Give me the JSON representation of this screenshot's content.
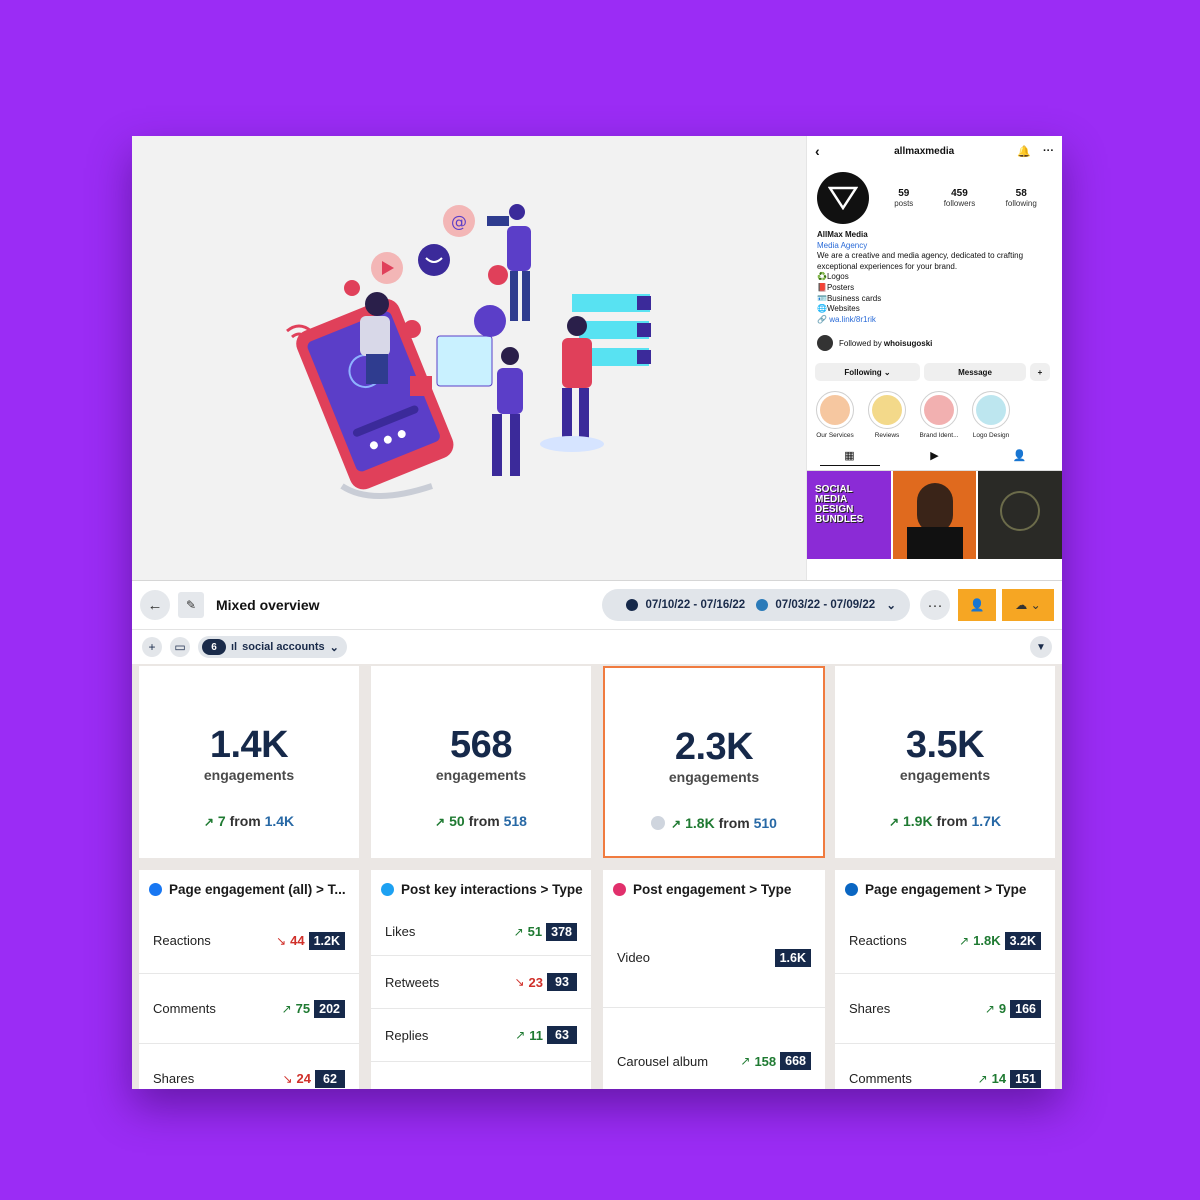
{
  "instagram": {
    "username": "allmaxmedia",
    "stats": [
      {
        "n": "59",
        "l": "posts"
      },
      {
        "n": "459",
        "l": "followers"
      },
      {
        "n": "58",
        "l": "following"
      }
    ],
    "name": "AllMax Media",
    "category": "Media Agency",
    "bio": "We are a creative and media agency, dedicated to crafting exceptional experiences for your brand.",
    "bio_items": [
      "♻️Logos",
      "📕Posters",
      "🪪Business cards",
      "🌐Websites"
    ],
    "link": "wa.link/8r1rik",
    "followed_by_prefix": "Followed by ",
    "followed_by": "whoisugoski",
    "buttons": {
      "following": "Following",
      "message": "Message"
    },
    "highlights": [
      "Our Services",
      "Reviews",
      "Brand Ident...",
      "Logo Design"
    ],
    "grid_post_text": "SOCIAL MEDIA DESIGN BUNDLES"
  },
  "toolbar": {
    "title": "Mixed overview",
    "range_a": "07/10/22 - 07/16/22",
    "range_b": "07/03/22 - 07/09/22",
    "colors": {
      "range_a": "#16294a",
      "range_b": "#2b7bb9",
      "accent": "#f6a623"
    }
  },
  "filter": {
    "count": "6",
    "label": "social accounts"
  },
  "kpis": [
    {
      "value": "1.4K",
      "label": "engagements",
      "delta": "7",
      "from": "from",
      "base": "1.4K"
    },
    {
      "value": "568",
      "label": "engagements",
      "delta": "50",
      "from": "from",
      "base": "518"
    },
    {
      "value": "2.3K",
      "label": "engagements",
      "delta": "1.8K",
      "from": "from",
      "base": "510"
    },
    {
      "value": "3.5K",
      "label": "engagements",
      "delta": "1.9K",
      "from": "from",
      "base": "1.7K"
    }
  ],
  "breakdowns": [
    {
      "title": "Page engagement (all) > T...",
      "network": "facebook",
      "color": "#1877f2",
      "rows": [
        {
          "label": "Reactions",
          "dir": "down",
          "delta": "44",
          "value": "1.2K"
        },
        {
          "label": "Comments",
          "dir": "up",
          "delta": "75",
          "value": "202"
        },
        {
          "label": "Shares",
          "dir": "down",
          "delta": "24",
          "value": "62"
        }
      ]
    },
    {
      "title": "Post key interactions > Type",
      "network": "twitter",
      "color": "#1da1f2",
      "rows": [
        {
          "label": "Likes",
          "dir": "up",
          "delta": "51",
          "value": "378"
        },
        {
          "label": "Retweets",
          "dir": "down",
          "delta": "23",
          "value": "93"
        },
        {
          "label": "Replies",
          "dir": "up",
          "delta": "11",
          "value": "63"
        }
      ]
    },
    {
      "title": "Post engagement > Type",
      "network": "instagram",
      "color": "#e1306c",
      "rows": [
        {
          "label": "Video",
          "dir": "",
          "delta": "",
          "value": "1.6K"
        },
        {
          "label": "Carousel album",
          "dir": "up",
          "delta": "158",
          "value": "668"
        }
      ]
    },
    {
      "title": "Page engagement > Type",
      "network": "linkedin",
      "color": "#0a66c2",
      "rows": [
        {
          "label": "Reactions",
          "dir": "up",
          "delta": "1.8K",
          "value": "3.2K"
        },
        {
          "label": "Shares",
          "dir": "up",
          "delta": "9",
          "value": "166"
        },
        {
          "label": "Comments",
          "dir": "up",
          "delta": "14",
          "value": "151"
        }
      ]
    }
  ]
}
